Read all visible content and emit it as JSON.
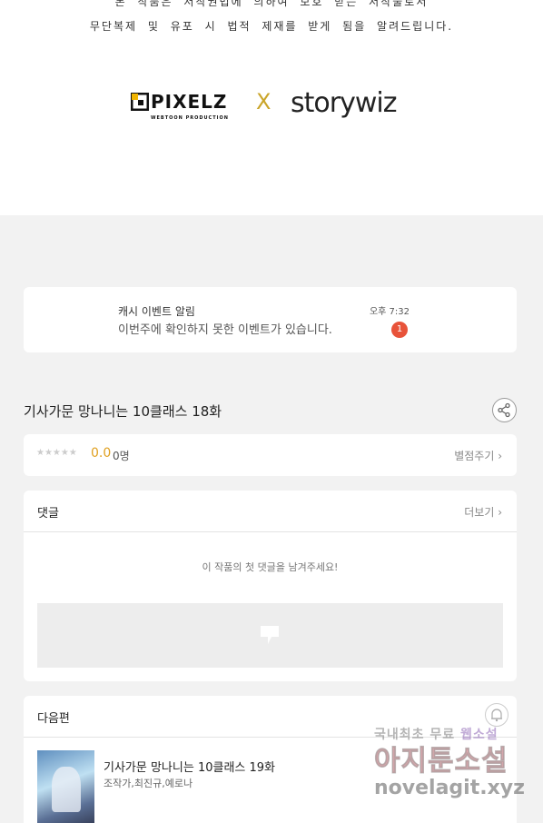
{
  "notice": {
    "line1": "본 작품은 저작권법에 의하여 보호 받는 저작물로서",
    "line2": "무단복제 및 유포 시 법적 제재를 받게 됨을 알려드립니다."
  },
  "logos": {
    "pixelz": "PIXELZ",
    "pixelz_sub": "WEBTOON PRODUCTION",
    "x": "X",
    "storywiz": "storywiz"
  },
  "notification": {
    "title": "캐시 이벤트 알림",
    "body": "이번주에 확인하지 못한 이벤트가 있습니다.",
    "time": "오후 7:32",
    "badge": "1"
  },
  "episode": {
    "title": "기사가문 망나니는 10클래스 18화"
  },
  "rating": {
    "stars": "★★★★★",
    "score": "0.0",
    "count": "0명",
    "rate_label": "별점주기 ›"
  },
  "comments": {
    "title": "댓글",
    "more": "더보기 ›",
    "empty": "이 작품의 첫 댓글을 남겨주세요!"
  },
  "next": {
    "title": "다음편",
    "episode_title": "기사가문 망나니는 10클래스 19화",
    "authors": "조작가,최진규,예로나"
  },
  "watermark": {
    "line1_a": "국내최초 무료 ",
    "line1_b": "웹소설",
    "line2": "아지툰소설",
    "line3": "novelagit.xyz"
  }
}
